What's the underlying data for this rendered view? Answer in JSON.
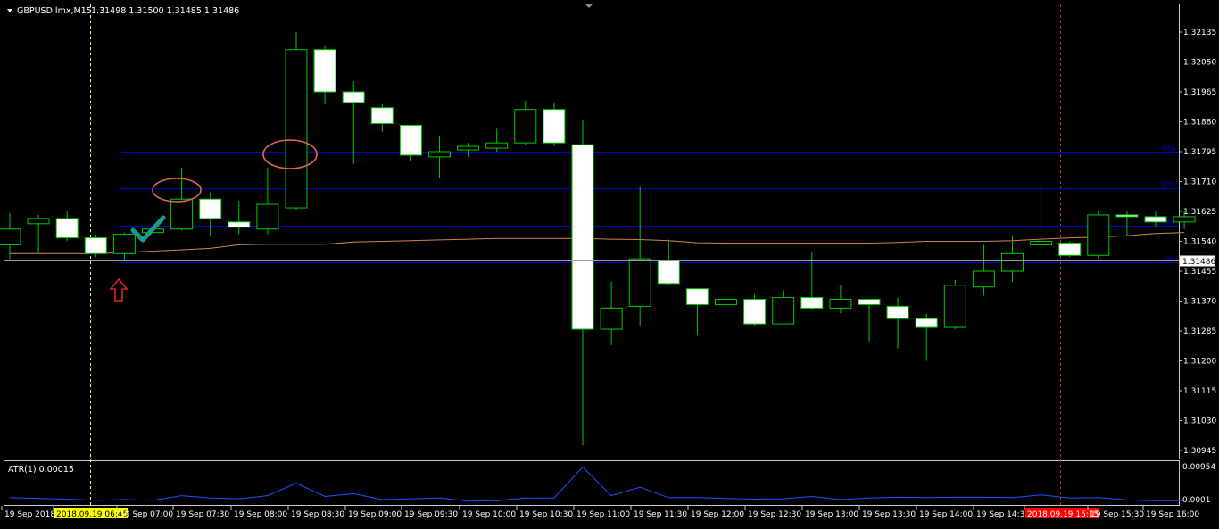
{
  "header": {
    "symbol_label": "GBPUSD.lmx,M15",
    "ohlc_label": "1.31498 1.31500 1.31485 1.31486"
  },
  "indicator": {
    "label": "ATR(1) 0.00015",
    "scale_labels": [
      "0.00954",
      "0.0001"
    ]
  },
  "price_axis": {
    "labels": [
      "1.32135",
      "1.32050",
      "1.31965",
      "1.31880",
      "1.31795",
      "1.31710",
      "1.31625",
      "1.31540",
      "1.31455",
      "1.31370",
      "1.31285",
      "1.31200",
      "1.31115",
      "1.31030",
      "1.30945"
    ],
    "current_price": "1.31486"
  },
  "level_tags": [
    "30%",
    "20%",
    "10%",
    "0%"
  ],
  "time_axis": {
    "labels": [
      "19 Sep 2018",
      "2018.09.19 06:45",
      "19 Sep 07:00",
      "19 Sep 07:30",
      "19 Sep 08:00",
      "19 Sep 08:30",
      "19 Sep 09:00",
      "19 Sep 09:30",
      "19 Sep 10:00",
      "19 Sep 10:30",
      "19 Sep 11:00",
      "19 Sep 11:30",
      "19 Sep 12:00",
      "19 Sep 12:30",
      "19 Sep 13:00",
      "19 Sep 13:30",
      "19 Sep 14:00",
      "19 Sep 14:30",
      "2018.09.19 15:15",
      "19 Sep 15:30",
      "19 Sep 16:00"
    ],
    "highlight_left": "2018.09.19 06:45",
    "highlight_right": "2018.09.19 15:15"
  },
  "colors": {
    "background": "#000000",
    "bull_candle_body": "#000000",
    "bear_candle_body": "#ffffff",
    "candle_outline": "#00cc00",
    "level_line": "#0000cc",
    "moving_average": "#d2825a",
    "atr_line": "#2050ff",
    "circle": "#e06a50",
    "arrow": "#e02020",
    "check": "#1a9c8c",
    "tag_left": "#ffff00",
    "tag_right": "#ff0000"
  },
  "chart_data": {
    "type": "candlestick",
    "symbol": "GBPUSD.lmx",
    "timeframe": "M15",
    "ylim": [
      1.3094,
      1.3218
    ],
    "candles": [
      {
        "o": 1.3153,
        "h": 1.3162,
        "l": 1.3149,
        "c": 1.31575
      },
      {
        "o": 1.3159,
        "h": 1.31615,
        "l": 1.31505,
        "c": 1.31605
      },
      {
        "o": 1.31605,
        "h": 1.31625,
        "l": 1.3154,
        "c": 1.3155
      },
      {
        "o": 1.3155,
        "h": 1.3156,
        "l": 1.31495,
        "c": 1.31505
      },
      {
        "o": 1.31505,
        "h": 1.31565,
        "l": 1.31485,
        "c": 1.3156
      },
      {
        "o": 1.31565,
        "h": 1.3162,
        "l": 1.3152,
        "c": 1.31575
      },
      {
        "o": 1.31575,
        "h": 1.3175,
        "l": 1.3157,
        "c": 1.3166
      },
      {
        "o": 1.3166,
        "h": 1.3168,
        "l": 1.31555,
        "c": 1.31605
      },
      {
        "o": 1.31595,
        "h": 1.31655,
        "l": 1.3156,
        "c": 1.3158
      },
      {
        "o": 1.31575,
        "h": 1.3175,
        "l": 1.3156,
        "c": 1.31645
      },
      {
        "o": 1.31635,
        "h": 1.32135,
        "l": 1.3163,
        "c": 1.32085
      },
      {
        "o": 1.32085,
        "h": 1.32095,
        "l": 1.3193,
        "c": 1.31965
      },
      {
        "o": 1.31965,
        "h": 1.31995,
        "l": 1.3176,
        "c": 1.31935
      },
      {
        "o": 1.3192,
        "h": 1.3193,
        "l": 1.3185,
        "c": 1.31875
      },
      {
        "o": 1.3187,
        "h": 1.3187,
        "l": 1.3177,
        "c": 1.31785
      },
      {
        "o": 1.3178,
        "h": 1.3184,
        "l": 1.3172,
        "c": 1.31795
      },
      {
        "o": 1.318,
        "h": 1.3182,
        "l": 1.3178,
        "c": 1.3181
      },
      {
        "o": 1.31805,
        "h": 1.3186,
        "l": 1.31795,
        "c": 1.3182
      },
      {
        "o": 1.3182,
        "h": 1.3194,
        "l": 1.31815,
        "c": 1.31915
      },
      {
        "o": 1.31915,
        "h": 1.31935,
        "l": 1.3181,
        "c": 1.3182
      },
      {
        "o": 1.31815,
        "h": 1.31885,
        "l": 1.3096,
        "c": 1.3129
      },
      {
        "o": 1.3129,
        "h": 1.31425,
        "l": 1.31245,
        "c": 1.3135
      },
      {
        "o": 1.31355,
        "h": 1.31695,
        "l": 1.313,
        "c": 1.3149
      },
      {
        "o": 1.31485,
        "h": 1.31545,
        "l": 1.31415,
        "c": 1.3142
      },
      {
        "o": 1.31405,
        "h": 1.31405,
        "l": 1.31275,
        "c": 1.3136
      },
      {
        "o": 1.3136,
        "h": 1.31395,
        "l": 1.3128,
        "c": 1.31375
      },
      {
        "o": 1.31375,
        "h": 1.3139,
        "l": 1.313,
        "c": 1.31305
      },
      {
        "o": 1.31305,
        "h": 1.314,
        "l": 1.31305,
        "c": 1.3138
      },
      {
        "o": 1.3138,
        "h": 1.3151,
        "l": 1.31345,
        "c": 1.3135
      },
      {
        "o": 1.3135,
        "h": 1.31415,
        "l": 1.31335,
        "c": 1.31375
      },
      {
        "o": 1.31375,
        "h": 1.31375,
        "l": 1.31255,
        "c": 1.3136
      },
      {
        "o": 1.31355,
        "h": 1.3138,
        "l": 1.31235,
        "c": 1.3132
      },
      {
        "o": 1.3132,
        "h": 1.31335,
        "l": 1.312,
        "c": 1.31295
      },
      {
        "o": 1.31295,
        "h": 1.3143,
        "l": 1.3129,
        "c": 1.31415
      },
      {
        "o": 1.3141,
        "h": 1.3153,
        "l": 1.31385,
        "c": 1.31455
      },
      {
        "o": 1.31455,
        "h": 1.31555,
        "l": 1.31425,
        "c": 1.31505
      },
      {
        "o": 1.3153,
        "h": 1.31705,
        "l": 1.31505,
        "c": 1.3154
      },
      {
        "o": 1.31535,
        "h": 1.3154,
        "l": 1.31495,
        "c": 1.315
      },
      {
        "o": 1.315,
        "h": 1.31625,
        "l": 1.3149,
        "c": 1.31615
      },
      {
        "o": 1.31615,
        "h": 1.31625,
        "l": 1.31555,
        "c": 1.3161
      },
      {
        "o": 1.3161,
        "h": 1.31625,
        "l": 1.3158,
        "c": 1.31595
      },
      {
        "o": 1.31595,
        "h": 1.31625,
        "l": 1.31575,
        "c": 1.3161
      }
    ],
    "moving_average": [
      1.31505,
      1.31505,
      1.31505,
      1.31505,
      1.31508,
      1.31512,
      1.31516,
      1.3152,
      1.3153,
      1.31532,
      1.31532,
      1.31532,
      1.31538,
      1.3154,
      1.31542,
      1.31544,
      1.31546,
      1.31548,
      1.31548,
      1.31548,
      1.31548,
      1.31546,
      1.31545,
      1.31542,
      1.31536,
      1.31535,
      1.31535,
      1.31535,
      1.31535,
      1.31535,
      1.31535,
      1.31537,
      1.3154,
      1.3154,
      1.3154,
      1.31542,
      1.31546,
      1.3155,
      1.31552,
      1.31556,
      1.31562,
      1.31565
    ],
    "levels": [
      {
        "label": "30%",
        "price": 1.31795
      },
      {
        "label": "20%",
        "price": 1.3169
      },
      {
        "label": "10%",
        "price": 1.31585
      },
      {
        "label": "0%",
        "price": 1.3148
      }
    ],
    "current_price": 1.31486,
    "atr": {
      "label": "ATR(1) 0.00015",
      "ylim": [
        0.0001,
        0.00954
      ],
      "values": [
        0.0013,
        0.0011,
        0.0009,
        0.0006,
        0.0008,
        0.0006,
        0.0018,
        0.0012,
        0.001,
        0.0018,
        0.005,
        0.0016,
        0.0023,
        0.0008,
        0.001,
        0.0012,
        0.0004,
        0.0005,
        0.0012,
        0.0012,
        0.0092,
        0.0018,
        0.004,
        0.0013,
        0.0013,
        0.0011,
        0.0009,
        0.001,
        0.0016,
        0.0008,
        0.0012,
        0.0014,
        0.0013,
        0.0014,
        0.0014,
        0.0013,
        0.002,
        0.0012,
        0.0013,
        0.0007,
        0.0005,
        0.0005
      ]
    }
  }
}
